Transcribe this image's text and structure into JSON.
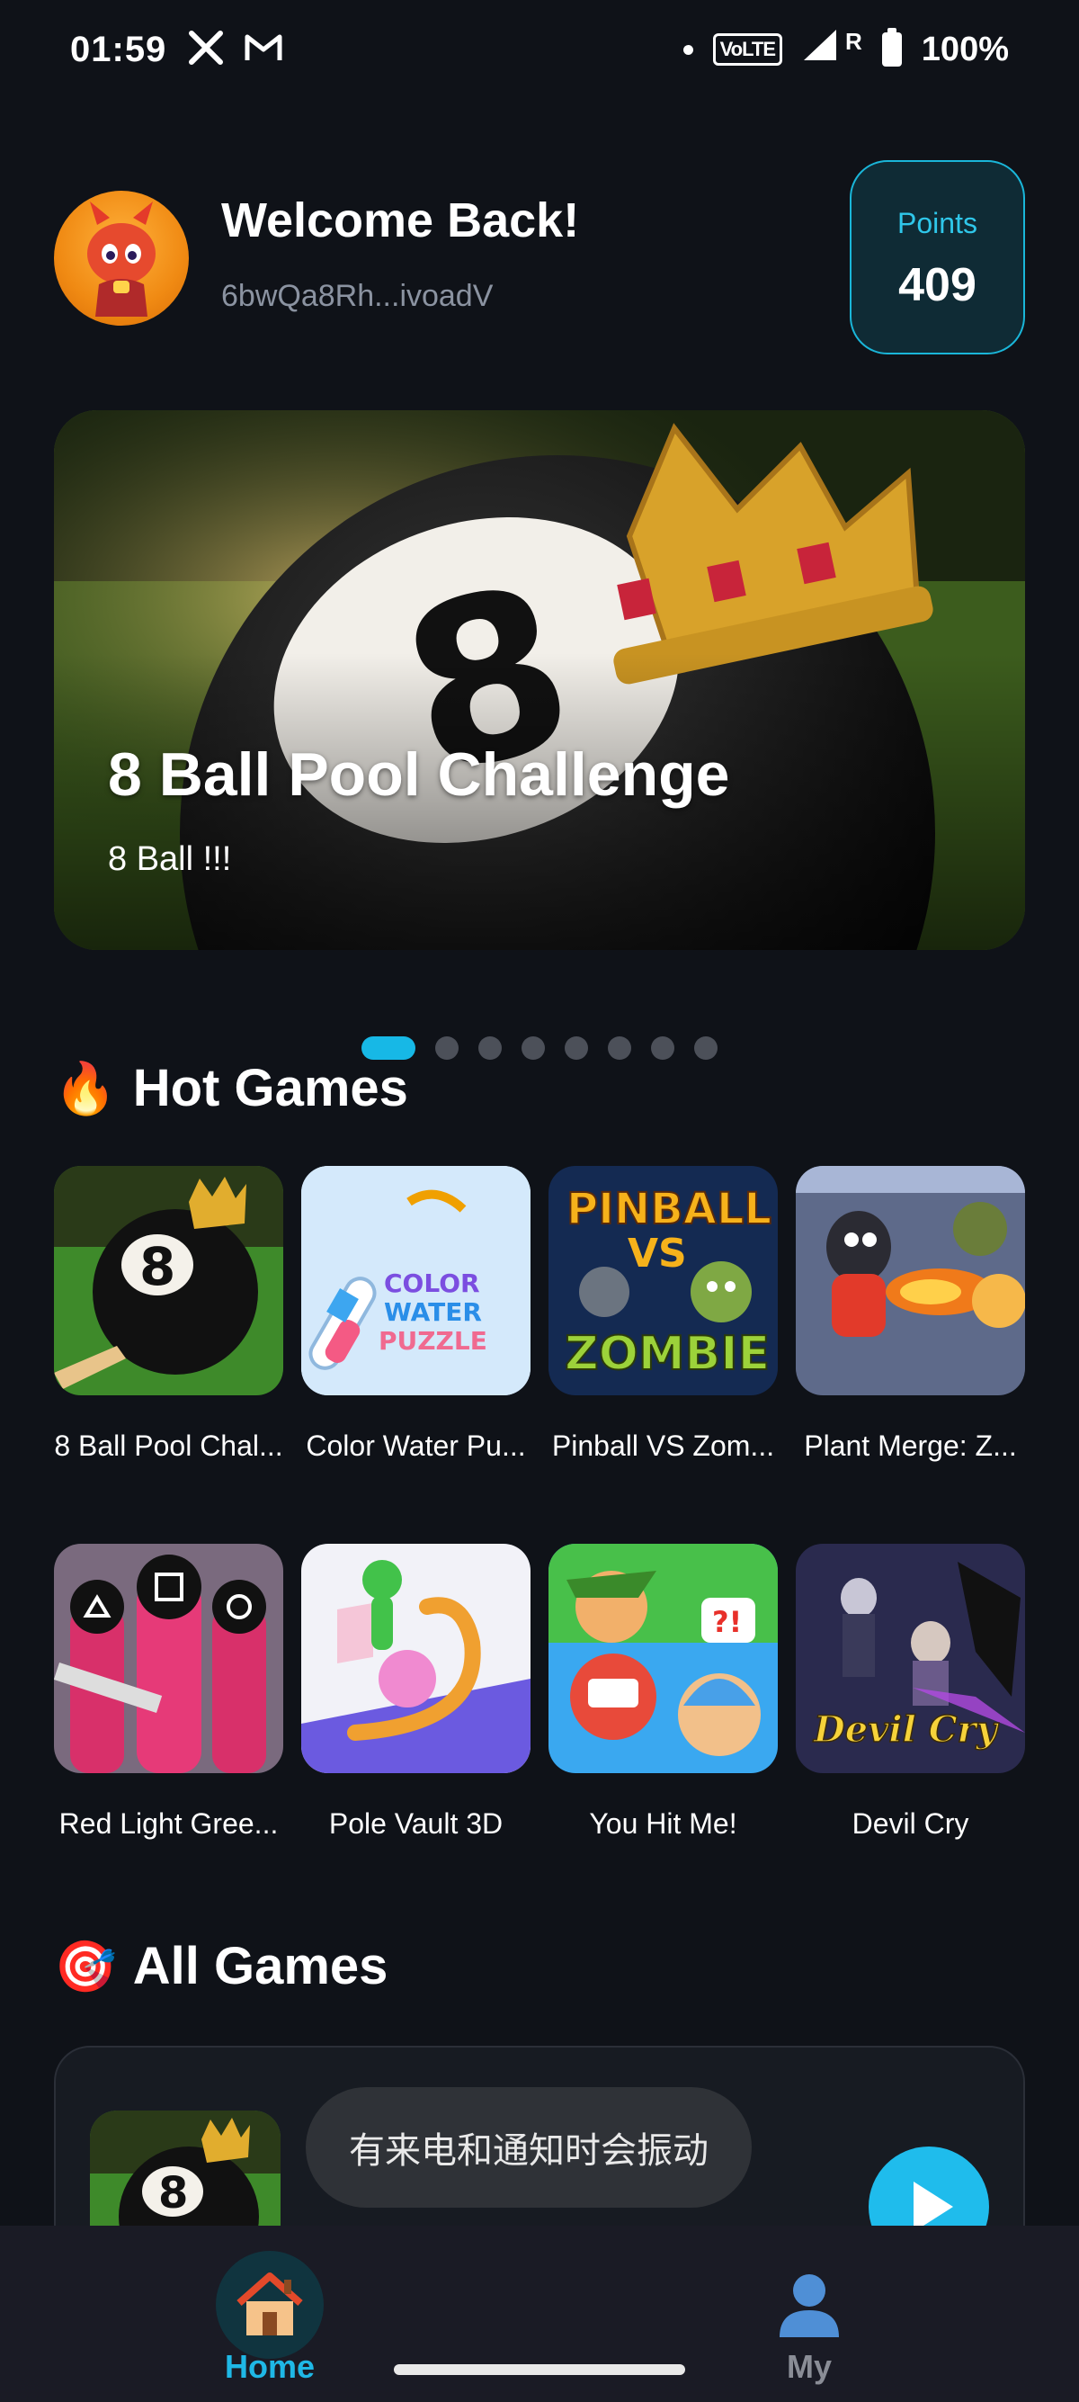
{
  "status_bar": {
    "time": "01:59",
    "left_icons": [
      "x-logo-icon",
      "gmail-icon"
    ],
    "volte": "VoLTE",
    "roaming": "R",
    "battery": "100%"
  },
  "header": {
    "welcome": "Welcome Back!",
    "wallet": "6bwQa8Rh...ivoadV",
    "points_label": "Points",
    "points_value": "409"
  },
  "banner": {
    "title": "8 Ball Pool Challenge",
    "subtitle": "8 Ball !!!",
    "page_count": 8,
    "active_page": 1
  },
  "hot_games": {
    "emoji": "🔥",
    "title": "Hot Games",
    "items": [
      {
        "name": "8 Ball Pool Chal...",
        "icon": "eight-ball-icon"
      },
      {
        "name": "Color Water Pu...",
        "icon": "color-water-puzzle-icon"
      },
      {
        "name": "Pinball VS Zom...",
        "icon": "pinball-zombie-icon"
      },
      {
        "name": "Plant Merge: Z...",
        "icon": "plant-merge-icon"
      },
      {
        "name": "Red Light Gree...",
        "icon": "red-light-guards-icon"
      },
      {
        "name": "Pole Vault 3D",
        "icon": "pole-vault-icon"
      },
      {
        "name": "You Hit Me!",
        "icon": "you-hit-me-icon"
      },
      {
        "name": "Devil Cry",
        "icon": "devil-cry-icon"
      }
    ]
  },
  "all_games": {
    "emoji": "🎯",
    "title": "All Games"
  },
  "toast": "有来电和通知时会振动",
  "bottom_nav": {
    "home": "Home",
    "my": "My"
  },
  "colors": {
    "accent": "#1fbcec",
    "background": "#0f1218",
    "card": "#171b22"
  }
}
